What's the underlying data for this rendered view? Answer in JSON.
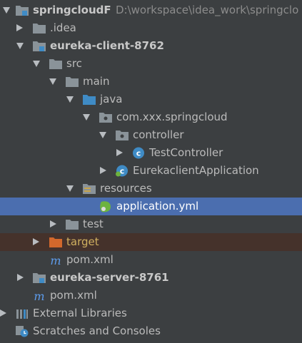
{
  "tree": {
    "project_root": {
      "name": "springcloudF",
      "path": "D:\\workspace\\idea_work\\springclo"
    },
    "idea_folder": ".idea",
    "client_module": "eureka-client-8762",
    "src": "src",
    "main": "main",
    "java": "java",
    "package": "com.xxx.springcloud",
    "controller_pkg": "controller",
    "test_controller": "TestController",
    "app_class": "EurekaclientApplication",
    "resources": "resources",
    "app_yml": "application.yml",
    "test_dir": "test",
    "target_dir": "target",
    "client_pom": "pom.xml",
    "server_module": "eureka-server-8761",
    "root_pom": "pom.xml",
    "external_libraries": "External Libraries",
    "scratches": "Scratches and Consoles"
  },
  "colors": {
    "background": "#3c3f41",
    "selection": "#4b6eaf",
    "excluded": "#45322b",
    "folder": "#8a9399",
    "source_folder": "#3f8bc5",
    "excluded_folder": "#d2682c",
    "maven_blue": "#5d9cec"
  }
}
